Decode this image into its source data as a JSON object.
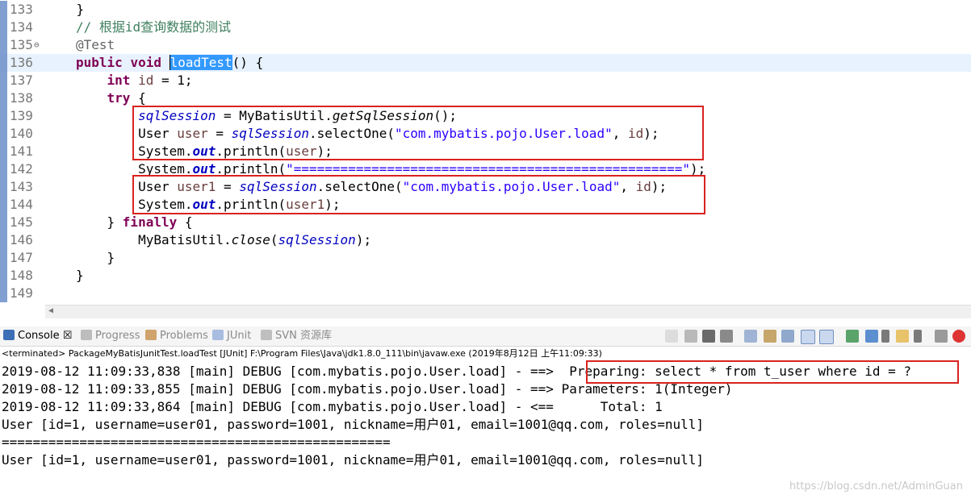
{
  "editor": {
    "lines": [
      {
        "no": "133",
        "text": "    }"
      },
      {
        "no": "134",
        "text": "    // 根据id查询数据的测试"
      },
      {
        "no": "135",
        "text": "    @Test"
      },
      {
        "no": "136",
        "text": "    public void loadTest() {"
      },
      {
        "no": "137",
        "text": "        int id = 1;"
      },
      {
        "no": "138",
        "text": "        try {"
      },
      {
        "no": "139",
        "text": "            sqlSession = MyBatisUtil.getSqlSession();"
      },
      {
        "no": "140",
        "text": "            User user = sqlSession.selectOne(\"com.mybatis.pojo.User.load\", id);"
      },
      {
        "no": "141",
        "text": "            System.out.println(user);"
      },
      {
        "no": "142",
        "text": "            System.out.println(\"==================================================\");"
      },
      {
        "no": "143",
        "text": "            User user1 = sqlSession.selectOne(\"com.mybatis.pojo.User.load\", id);"
      },
      {
        "no": "144",
        "text": "            System.out.println(user1);"
      },
      {
        "no": "145",
        "text": "        } finally {"
      },
      {
        "no": "146",
        "text": "            MyBatisUtil.close(sqlSession);"
      },
      {
        "no": "147",
        "text": "        }"
      },
      {
        "no": "148",
        "text": "    }"
      },
      {
        "no": "149",
        "text": ""
      }
    ],
    "fold_marker": "⊖",
    "comment": "// 根据id查询数据的测试",
    "annotation": "@Test",
    "kw_public": "public",
    "kw_void": "void",
    "method_name": "loadTest",
    "kw_int": "int",
    "kw_try": "try",
    "kw_finally": "finally",
    "ident_sqlSession": "sqlSession",
    "ident_MyBatisUtil": "MyBatisUtil",
    "ident_getSqlSession": "getSqlSession",
    "ident_User": "User",
    "ident_user": "user",
    "ident_user1": "user1",
    "ident_selectOne": "selectOne",
    "ident_System": "System",
    "ident_out": "out",
    "ident_println": "println",
    "ident_close": "close",
    "ident_id": "id",
    "str_load": "\"com.mybatis.pojo.User.load\"",
    "str_sep": "\"==================================================\""
  },
  "tabs": [
    {
      "label": "Console ☒",
      "active": true
    },
    {
      "label": "Progress",
      "active": false
    },
    {
      "label": "Problems",
      "active": false
    },
    {
      "label": "JUnit",
      "active": false
    },
    {
      "label": "SVN 资源库",
      "active": false
    }
  ],
  "console": {
    "status": "<terminated> PackageMyBatisJunitTest.loadTest [JUnit] F:\\Program Files\\Java\\jdk1.8.0_111\\bin\\javaw.exe (2019年8月12日 上午11:09:33)",
    "lines": [
      "2019-08-12 11:09:33,838 [main] DEBUG [com.mybatis.pojo.User.load] - ==>  Preparing: select * from t_user where id = ?",
      "2019-08-12 11:09:33,855 [main] DEBUG [com.mybatis.pojo.User.load] - ==> Parameters: 1(Integer)",
      "2019-08-12 11:09:33,864 [main] DEBUG [com.mybatis.pojo.User.load] - <==      Total: 1",
      "User [id=1, username=user01, password=1001, nickname=用户01, email=1001@qq.com, roles=null]",
      "==================================================",
      "User [id=1, username=user01, password=1001, nickname=用户01, email=1001@qq.com, roles=null]"
    ]
  },
  "watermark": "https://blog.csdn.net/AdminGuan",
  "colors": {
    "keyword": "#7f0055",
    "comment": "#3f7f5f",
    "string": "#2a00ff",
    "field": "#0000c0",
    "highlight_box": "#d9231f",
    "selection": "#3399ff"
  }
}
